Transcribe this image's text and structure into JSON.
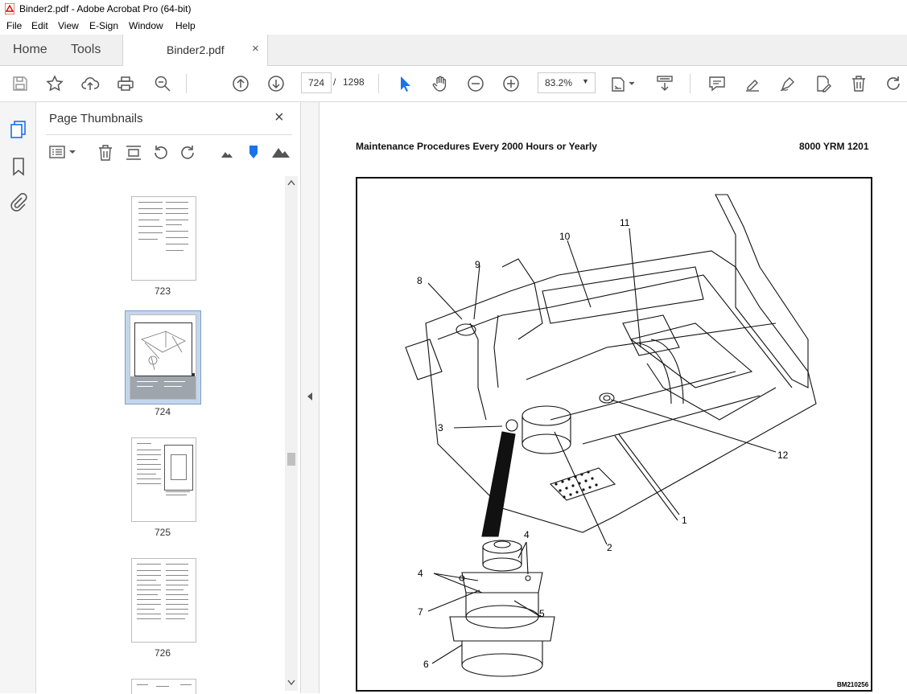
{
  "window": {
    "title": "Binder2.pdf - Adobe Acrobat Pro (64-bit)"
  },
  "menu": [
    "File",
    "Edit",
    "View",
    "E-Sign",
    "Window",
    "Help"
  ],
  "tabs": {
    "home": "Home",
    "tools": "Tools",
    "document": "Binder2.pdf",
    "close": "×"
  },
  "toolbar": {
    "current_page": "724",
    "separator": "/",
    "total_pages": "1298",
    "zoom": "83.2%"
  },
  "thumbnails_panel": {
    "title": "Page Thumbnails",
    "close": "×",
    "pages": [
      {
        "label": "723"
      },
      {
        "label": "724",
        "selected": true
      },
      {
        "label": "725"
      },
      {
        "label": "726"
      }
    ]
  },
  "document": {
    "header_left": "Maintenance Procedures Every 2000 Hours or Yearly",
    "header_right": "8000 YRM 1201",
    "figure_code": "BM210256",
    "callouts": [
      "1",
      "2",
      "3",
      "4",
      "4",
      "5",
      "6",
      "7",
      "8",
      "9",
      "10",
      "11",
      "12"
    ]
  },
  "colors": {
    "accent": "#1a73e8",
    "toolbar_bg": "#ffffff",
    "panel_bg": "#f5f5f5",
    "selection": "#c6d6ea"
  }
}
